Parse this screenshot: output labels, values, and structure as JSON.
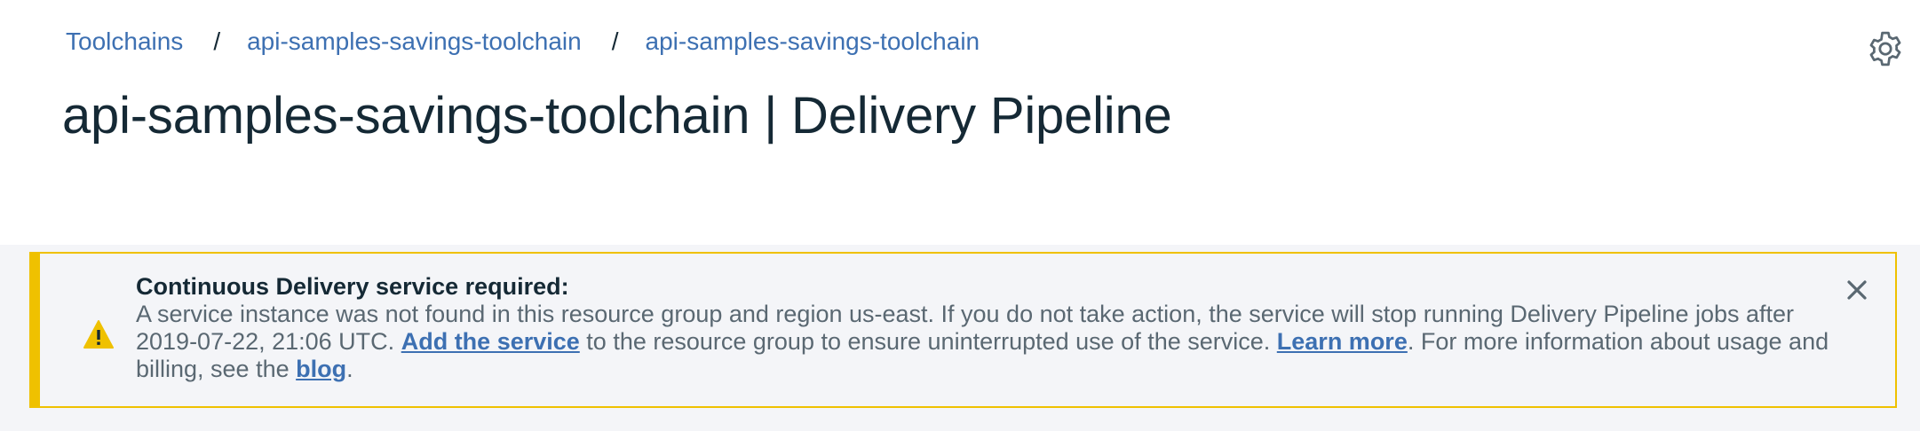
{
  "breadcrumb": {
    "items": [
      {
        "label": "Toolchains"
      },
      {
        "label": "api-samples-savings-toolchain"
      },
      {
        "label": "api-samples-savings-toolchain"
      }
    ],
    "separator": "/"
  },
  "page": {
    "title": "api-samples-savings-toolchain | Delivery Pipeline"
  },
  "header": {
    "settings_icon": "gear-icon"
  },
  "notification": {
    "kind": "warning",
    "icon": "warning-icon",
    "title": "Continuous Delivery service required:",
    "text_part1": "A service instance was not found in this resource group and region us-east. If you do not take action, the service will stop running Delivery Pipeline jobs after 2019-07-22, 21:06 UTC.",
    "add_service_link": "Add the service",
    "text_part2": "to the resource group to ensure uninterrupted use of the service.",
    "learn_more_link": "Learn more",
    "text_part3": ". For more information about usage and billing, see the",
    "blog_link": "blog",
    "text_part4": ".",
    "close_icon": "close-icon"
  },
  "colors": {
    "link": "#3d70b2",
    "warning_accent": "#efc100",
    "text_primary": "#152935",
    "text_secondary": "#5a6872",
    "banner_background": "#f4f5f8"
  }
}
